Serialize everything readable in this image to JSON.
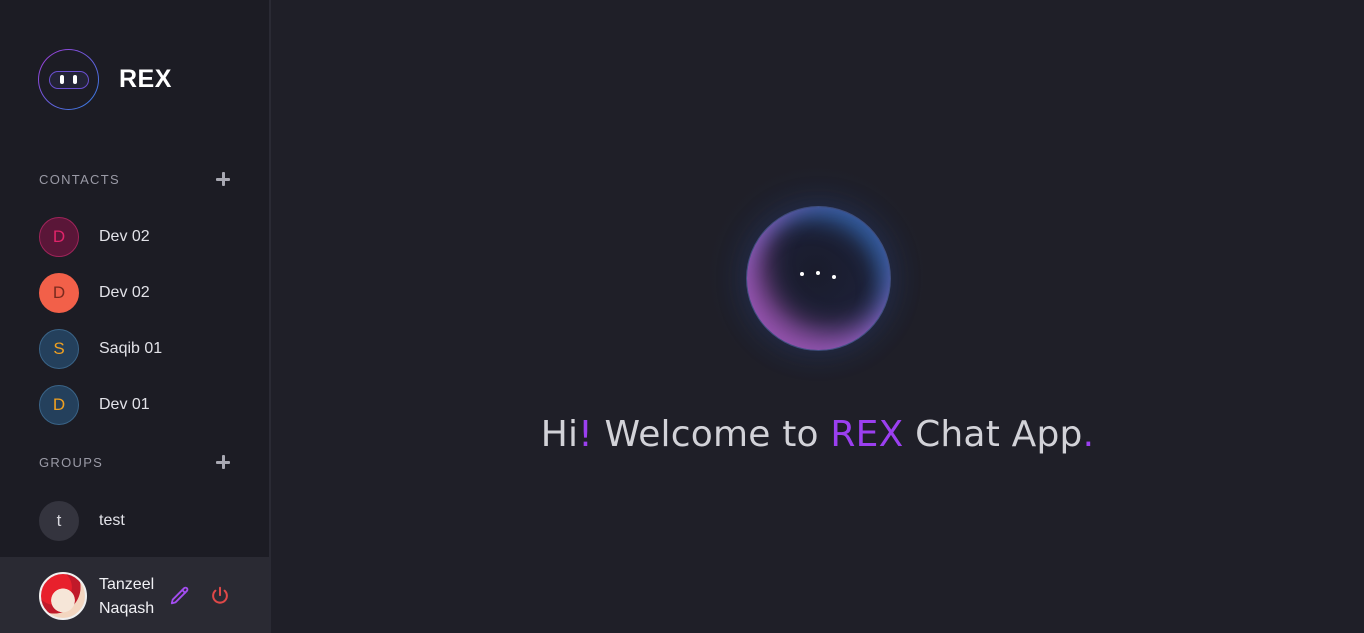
{
  "app": {
    "name": "REX"
  },
  "colors": {
    "accent": "#9b3ff0",
    "background": "#1f1f28",
    "sidebar": "#1c1c24",
    "logout": "#e04848"
  },
  "contacts": {
    "label": "CONTACTS",
    "items": [
      {
        "initial": "D",
        "name": "Dev 02",
        "bg": "#5a1638",
        "border": "#a0245a",
        "fg": "#e0246a"
      },
      {
        "initial": "D",
        "name": "Dev 02",
        "bg": "#f26049",
        "border": "#f26049",
        "fg": "#7a2a1e"
      },
      {
        "initial": "S",
        "name": "Saqib 01",
        "bg": "#24405c",
        "border": "#3a6488",
        "fg": "#f0a020"
      },
      {
        "initial": "D",
        "name": "Dev 01",
        "bg": "#24405c",
        "border": "#3a6488",
        "fg": "#f0a020"
      }
    ]
  },
  "groups": {
    "label": "GROUPS",
    "items": [
      {
        "initial": "t",
        "name": "test",
        "bg": "#34343e",
        "border": "#34343e",
        "fg": "#d8d8de"
      }
    ]
  },
  "user": {
    "first_name": "Tanzeel",
    "last_name": "Naqash"
  },
  "icons": {
    "add": "plus-icon",
    "edit": "pencil-icon",
    "logout": "power-icon"
  },
  "welcome": {
    "hi": "Hi",
    "bang": "!",
    "middle": " Welcome to ",
    "brand": "REX",
    "tail": " Chat App",
    "dot": "."
  }
}
